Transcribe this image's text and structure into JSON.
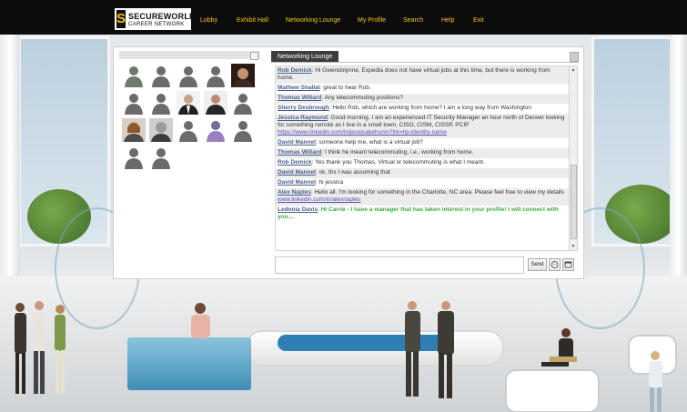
{
  "brand": {
    "line1": "SECUREWORLD",
    "line2": "CAREER NETWORK",
    "mark": "S"
  },
  "nav": [
    {
      "label": "Lobby"
    },
    {
      "label": "Exhibit Hall"
    },
    {
      "label": "Networking Lounge"
    },
    {
      "label": "My Profile"
    },
    {
      "label": "Search"
    },
    {
      "label": "Help"
    },
    {
      "label": "Exit"
    }
  ],
  "panel": {
    "tab_label": "Networking Lounge",
    "send_label": "Send"
  },
  "colors": {
    "topbar": "#0c0c0c",
    "nav_text": "#f3c623",
    "author": "#4a5e8a",
    "highlight": "#3aad3a",
    "tab": "#3d3d3d"
  },
  "icons": [
    "emoticon-icon",
    "window-icon"
  ],
  "chat": {
    "messages": [
      {
        "author": "Rob Demick",
        "text": " Hi Gwendolynne, Expedia does not have virtual jobs at this time, but there is working from home."
      },
      {
        "author": "Mathew Shallal",
        "text": " great to hear Rob."
      },
      {
        "author": "Thomas Willard",
        "text": " Any telecommuting positions?"
      },
      {
        "author": "Sherry Desbrough",
        "text": " Hello Rob, which are working from home? I am a long way from Washington"
      },
      {
        "author": "Jessica Raymond",
        "text": " Good morning. I am an experienced IT Security Manager an hour north of Denver looking for something remote as I live in a small town. CISO, CISM, CISSP, PCIP ",
        "link": "https://www.linkedin.com/in/jessicabehunin?trk=hp-identity-name"
      },
      {
        "author": "David Mannel",
        "text": " someone help me, what is a virtual job?"
      },
      {
        "author": "Thomas Willard",
        "text": " I think he meant telecommuting, i.e., working from home."
      },
      {
        "author": "Rob Demick",
        "text": " Yes thank you Thomas, Virtual or telecommuting is what I meant."
      },
      {
        "author": "David Mannel",
        "text": " ok, thx I was assuming that"
      },
      {
        "author": "David Mannel",
        "text": " hi jessica"
      },
      {
        "author": "Alex Naples",
        "text": " Hello all. I'm looking for something in the Charlotte, NC area. Please feel free to view my details ",
        "link": "www.linkedin.com/in/alexnaples"
      },
      {
        "author": "Ledonia Davis",
        "text": " Hi Carrie - I have a manager that has taken interest in your profile! I will connect with you....",
        "highlight": true
      }
    ]
  }
}
